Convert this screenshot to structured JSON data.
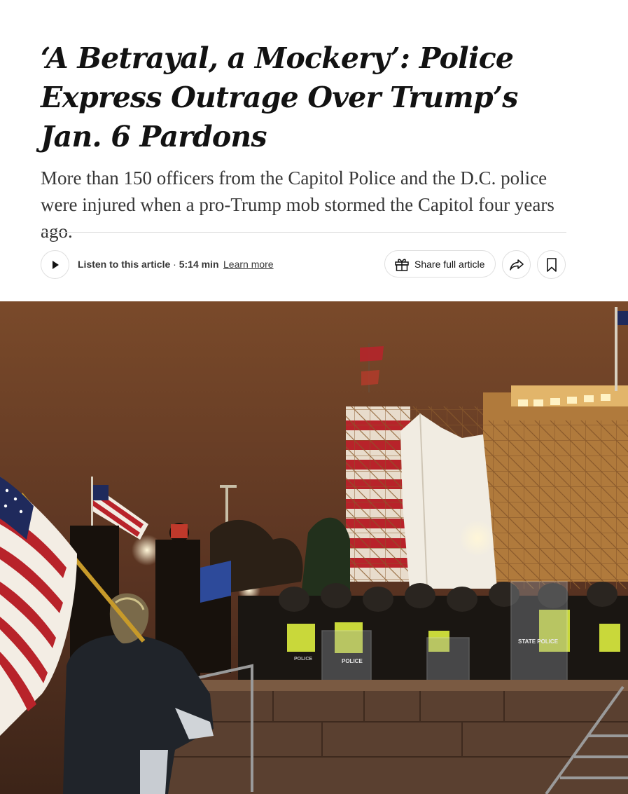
{
  "article": {
    "headline": "‘A Betrayal, a Mockery’: Police Express Outrage Over Trump’s Jan. 6 Pardons",
    "summary": "More than 150 officers from the Capitol Police and the D.C. police were injured when a pro-Trump mob stormed the Capitol four years ago."
  },
  "toolbar": {
    "listen_label": "Listen to this article",
    "separator": " · ",
    "duration": "5:14 min",
    "learn_more": "Learn more",
    "share_label": "Share full article",
    "icons": [
      "play-icon",
      "gift-icon",
      "share-arrow-icon",
      "bookmark-icon"
    ]
  },
  "photo": {
    "shield_text_1": "STATE POLICE",
    "shield_text_2": "POLICE",
    "shield_text_3": "POLICE",
    "colors": {
      "sky": "#7a4a2a",
      "sky_dark": "#3c2418",
      "building": "#d8a55a",
      "stone": "#5a4030",
      "vest": "#c9d83a",
      "flag_red": "#b8232a",
      "flag_blue": "#1f2a5c"
    }
  }
}
